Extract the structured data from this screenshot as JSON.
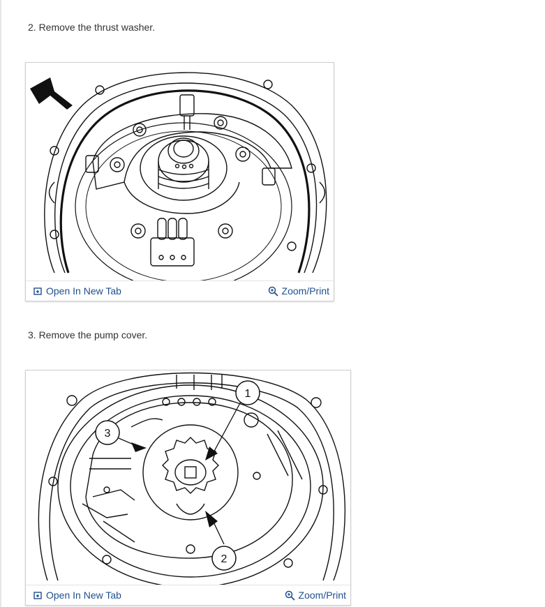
{
  "steps": [
    {
      "text": "2. Remove the thrust washer.",
      "figure": {
        "image_name": "thrust-washer-illustration",
        "open_label": "Open In New Tab",
        "zoom_label": "Zoom/Print"
      }
    },
    {
      "text": "3. Remove the pump cover.",
      "figure": {
        "image_name": "pump-cover-illustration",
        "callouts": [
          "1",
          "2",
          "3"
        ],
        "open_label": "Open In New Tab",
        "zoom_label": "Zoom/Print"
      }
    }
  ],
  "colors": {
    "link": "#1e4f8f",
    "text": "#333333",
    "border": "#cfcfcf"
  },
  "icons": {
    "open": "open-new-tab-icon",
    "zoom": "zoom-icon"
  }
}
